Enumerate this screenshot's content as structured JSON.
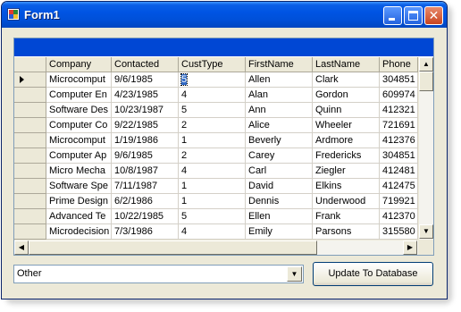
{
  "window": {
    "title": "Form1",
    "title_bar_color": "#0054e3"
  },
  "grid": {
    "caption": "",
    "caption_color": "#0047d4",
    "columns": [
      "Company",
      "Contacted",
      "CustType",
      "FirstName",
      "LastName",
      "Phone"
    ],
    "rows": [
      [
        "Microcomput",
        "9/6/1985",
        "5",
        "Allen",
        "Clark",
        "304851"
      ],
      [
        "Computer En",
        "4/23/1985",
        "4",
        "Alan",
        "Gordon",
        "609974"
      ],
      [
        "Software Des",
        "10/23/1987",
        "5",
        "Ann",
        "Quinn",
        "412321"
      ],
      [
        "Computer Co",
        "9/22/1985",
        "2",
        "Alice",
        "Wheeler",
        "721691"
      ],
      [
        "Microcomput",
        "1/19/1986",
        "1",
        "Beverly",
        "Ardmore",
        "412376"
      ],
      [
        "Computer Ap",
        "9/6/1985",
        "2",
        "Carey",
        "Fredericks",
        "304851"
      ],
      [
        "Micro Mecha",
        "10/8/1987",
        "4",
        "Carl",
        "Ziegler",
        "412481"
      ],
      [
        "Software Spe",
        "7/11/1987",
        "1",
        "David",
        "Elkins",
        "412475"
      ],
      [
        "Prime Design",
        "6/2/1986",
        "1",
        "Dennis",
        "Underwood",
        "719921"
      ],
      [
        "Advanced Te",
        "10/22/1985",
        "5",
        "Ellen",
        "Frank",
        "412370"
      ],
      [
        "Microdecision",
        "7/3/1986",
        "4",
        "Emily",
        "Parsons",
        "315580"
      ]
    ],
    "current_row": 0,
    "selected_cell": "5"
  },
  "controls": {
    "combo_value": "Other",
    "update_button_label": "Update To Database"
  }
}
